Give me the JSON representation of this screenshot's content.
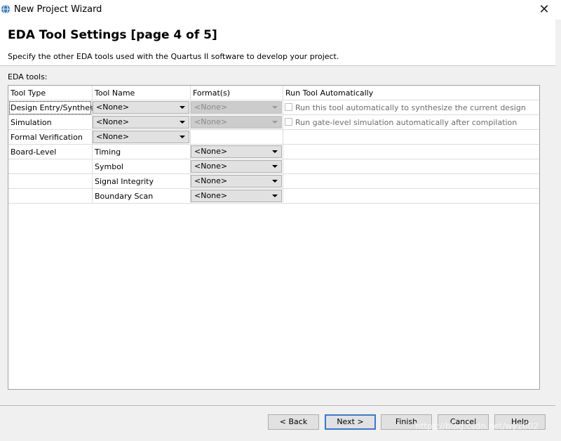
{
  "window": {
    "title": "New Project Wizard",
    "close_glyph": "✕"
  },
  "header": {
    "title": "EDA Tool Settings [page 4 of 5]",
    "description": "Specify the other EDA tools used with the Quartus II software to develop your project."
  },
  "section_label": "EDA tools:",
  "table": {
    "columns": [
      "Tool Type",
      "Tool Name",
      "Format(s)",
      "Run Tool Automatically"
    ],
    "rows": [
      {
        "tool_type": "Design Entry/Synthesis",
        "tool_name": "<None>",
        "format": "<None>",
        "run_auto": "Run this tool automatically to synthesize the current design",
        "checked": false
      },
      {
        "tool_type": "Simulation",
        "tool_name": "<None>",
        "format": "<None>",
        "run_auto": "Run gate-level simulation automatically after compilation",
        "checked": false
      },
      {
        "tool_type": "Formal Verification",
        "tool_name": "<None>"
      },
      {
        "tool_type": "Board-Level",
        "tool_name": "Timing",
        "format": "<None>"
      },
      {
        "tool_type": "",
        "tool_name": "Symbol",
        "format": "<None>"
      },
      {
        "tool_type": "",
        "tool_name": "Signal Integrity",
        "format": "<None>"
      },
      {
        "tool_type": "",
        "tool_name": "Boundary Scan",
        "format": "<None>"
      }
    ]
  },
  "buttons": {
    "back": "< Back",
    "next": "Next >",
    "finish": "Finish",
    "cancel": "Cancel",
    "help": "Help"
  },
  "watermark": "https://blog.csdn.net/wy1602",
  "icons": {
    "app": "quartus-globe-icon"
  }
}
